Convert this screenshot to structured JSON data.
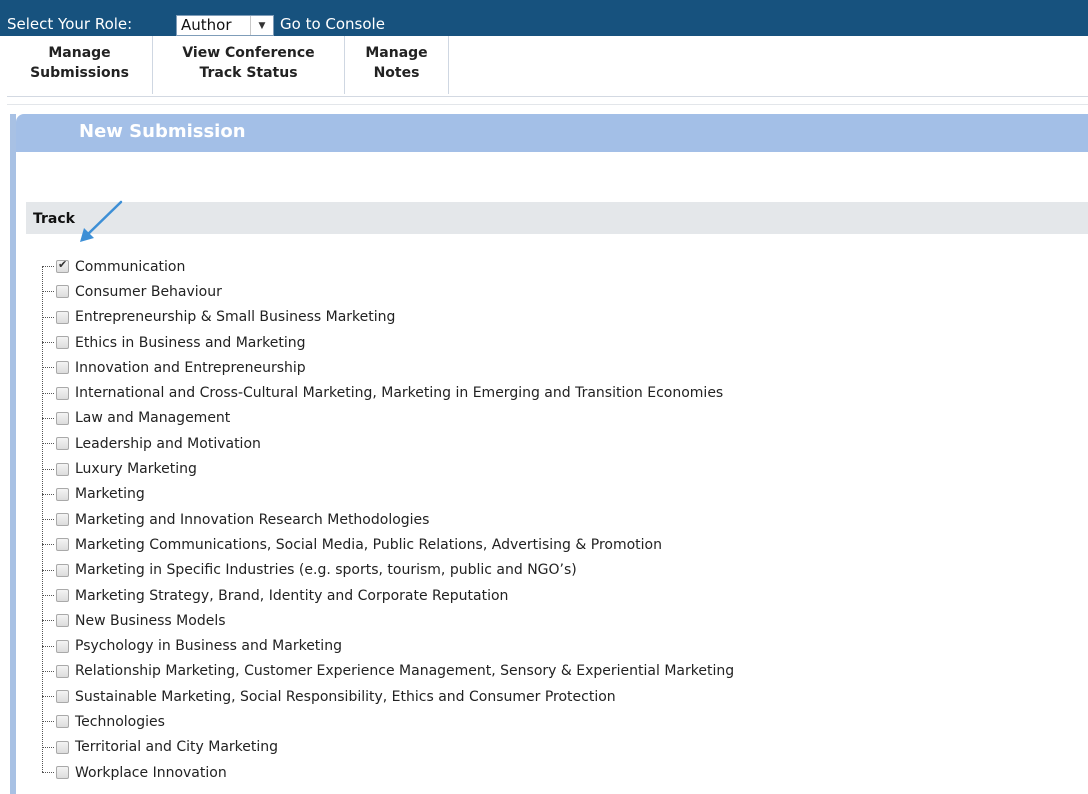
{
  "topbar": {
    "role_label": "Select Your Role:",
    "role_value": "Author",
    "console_link": "Go to Console"
  },
  "menu": [
    {
      "line1": "Manage",
      "line2": "Submissions"
    },
    {
      "line1": "View Conference",
      "line2": "Track Status"
    },
    {
      "line1": "Manage",
      "line2": "Notes"
    }
  ],
  "panel": {
    "title": "New Submission"
  },
  "track": {
    "label": "Track",
    "items": [
      {
        "label": "Communication",
        "checked": true
      },
      {
        "label": "Consumer Behaviour",
        "checked": false
      },
      {
        "label": "Entrepreneurship & Small Business Marketing",
        "checked": false
      },
      {
        "label": "Ethics in Business and Marketing",
        "checked": false
      },
      {
        "label": "Innovation and Entrepreneurship",
        "checked": false
      },
      {
        "label": "International and Cross-Cultural Marketing, Marketing in Emerging and Transition Economies",
        "checked": false
      },
      {
        "label": "Law and Management",
        "checked": false
      },
      {
        "label": "Leadership and Motivation",
        "checked": false
      },
      {
        "label": "Luxury Marketing",
        "checked": false
      },
      {
        "label": "Marketing",
        "checked": false
      },
      {
        "label": "Marketing and Innovation Research Methodologies",
        "checked": false
      },
      {
        "label": "Marketing Communications, Social Media, Public Relations, Advertising & Promotion",
        "checked": false
      },
      {
        "label": "Marketing in Specific Industries (e.g. sports, tourism, public and NGO’s)",
        "checked": false
      },
      {
        "label": "Marketing Strategy, Brand, Identity and Corporate Reputation",
        "checked": false
      },
      {
        "label": "New Business Models",
        "checked": false
      },
      {
        "label": "Psychology in Business and Marketing",
        "checked": false
      },
      {
        "label": "Relationship Marketing, Customer Experience Management, Sensory & Experiential Marketing",
        "checked": false
      },
      {
        "label": "Sustainable Marketing, Social Responsibility, Ethics and Consumer Protection",
        "checked": false
      },
      {
        "label": "Technologies",
        "checked": false
      },
      {
        "label": "Territorial and City Marketing",
        "checked": false
      },
      {
        "label": "Workplace Innovation",
        "checked": false
      }
    ]
  },
  "colors": {
    "topbar": "#17527e",
    "panel_header": "#a3bfe7",
    "track_bar": "#e4e7ea",
    "annotation_arrow": "#3d8fd6"
  }
}
